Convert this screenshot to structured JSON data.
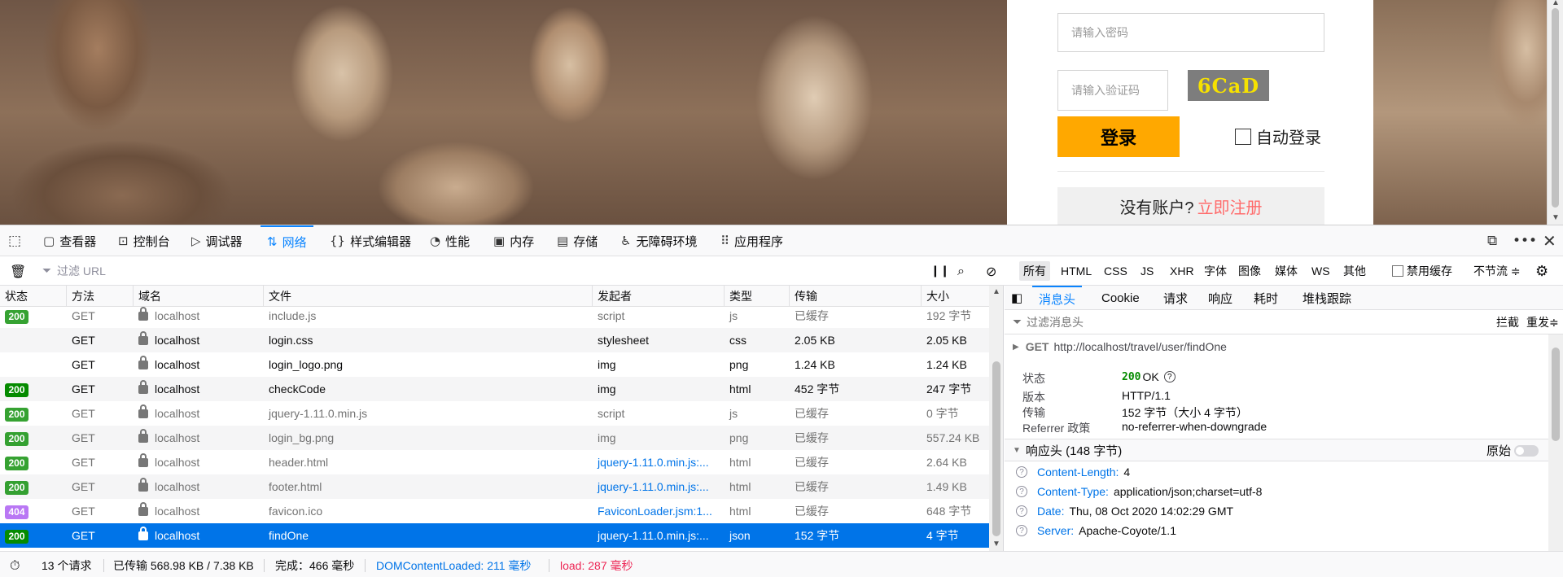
{
  "webpage": {
    "password_placeholder": "请输入密码",
    "captcha_placeholder": "请输入验证码",
    "captcha_code": "6CaD",
    "login_label": "登录",
    "auto_login_label": "自动登录",
    "no_account_text": "没有账户?",
    "register_link": "立即注册"
  },
  "devtools": {
    "tabs": [
      {
        "label": "查看器",
        "icon": "inspector-icon"
      },
      {
        "label": "控制台",
        "icon": "console-icon"
      },
      {
        "label": "调试器",
        "icon": "debugger-icon"
      },
      {
        "label": "网络",
        "icon": "network-icon"
      },
      {
        "label": "样式编辑器",
        "icon": "style-editor-icon"
      },
      {
        "label": "性能",
        "icon": "performance-icon"
      },
      {
        "label": "内存",
        "icon": "memory-icon"
      },
      {
        "label": "存储",
        "icon": "storage-icon"
      },
      {
        "label": "无障碍环境",
        "icon": "accessibility-icon"
      },
      {
        "label": "应用程序",
        "icon": "application-icon"
      }
    ],
    "active_tab": "网络",
    "filter_placeholder": "过滤 URL",
    "type_filters": [
      "所有",
      "HTML",
      "CSS",
      "JS",
      "XHR",
      "字体",
      "图像",
      "媒体",
      "WS",
      "其他"
    ],
    "active_type_filter": "所有",
    "disable_cache_label": "禁用缓存",
    "throttle_label": "不节流 ≑"
  },
  "requests": {
    "columns": [
      "状态",
      "方法",
      "域名",
      "文件",
      "发起者",
      "类型",
      "传输",
      "大小"
    ],
    "rows": [
      {
        "status": "200",
        "method": "GET",
        "domain": "localhost",
        "file": "include.js",
        "initiator": "script",
        "type": "js",
        "transferred": "已缓存",
        "size": "192 字节",
        "cached": true
      },
      {
        "status": "",
        "method": "GET",
        "domain": "localhost",
        "file": "login.css",
        "initiator": "stylesheet",
        "type": "css",
        "transferred": "2.05 KB",
        "size": "2.05 KB",
        "cached": false
      },
      {
        "status": "",
        "method": "GET",
        "domain": "localhost",
        "file": "login_logo.png",
        "initiator": "img",
        "type": "png",
        "transferred": "1.24 KB",
        "size": "1.24 KB",
        "cached": false
      },
      {
        "status": "200",
        "method": "GET",
        "domain": "localhost",
        "file": "checkCode",
        "initiator": "img",
        "type": "html",
        "transferred": "452 字节",
        "size": "247 字节",
        "cached": false
      },
      {
        "status": "200",
        "method": "GET",
        "domain": "localhost",
        "file": "jquery-1.11.0.min.js",
        "initiator": "script",
        "type": "js",
        "transferred": "已缓存",
        "size": "0 字节",
        "cached": true
      },
      {
        "status": "200",
        "method": "GET",
        "domain": "localhost",
        "file": "login_bg.png",
        "initiator": "img",
        "type": "png",
        "transferred": "已缓存",
        "size": "557.24 KB",
        "cached": true
      },
      {
        "status": "200",
        "method": "GET",
        "domain": "localhost",
        "file": "header.html",
        "initiator": "jquery-1.11.0.min.js:...",
        "type": "html",
        "transferred": "已缓存",
        "size": "2.64 KB",
        "cached": true,
        "initiator_link": true
      },
      {
        "status": "200",
        "method": "GET",
        "domain": "localhost",
        "file": "footer.html",
        "initiator": "jquery-1.11.0.min.js:...",
        "type": "html",
        "transferred": "已缓存",
        "size": "1.49 KB",
        "cached": true,
        "initiator_link": true
      },
      {
        "status": "404",
        "method": "GET",
        "domain": "localhost",
        "file": "favicon.ico",
        "initiator": "FaviconLoader.jsm:1...",
        "type": "html",
        "transferred": "已缓存",
        "size": "648 字节",
        "cached": true,
        "initiator_link": true
      },
      {
        "status": "200",
        "method": "GET",
        "domain": "localhost",
        "file": "findOne",
        "initiator": "jquery-1.11.0.min.js:...",
        "type": "json",
        "transferred": "152 字节",
        "size": "4 字节",
        "cached": false,
        "selected": true,
        "initiator_link": true
      }
    ]
  },
  "details": {
    "tabs": [
      "消息头",
      "Cookie",
      "请求",
      "响应",
      "耗时",
      "堆栈跟踪"
    ],
    "active_tab": "消息头",
    "filter_placeholder": "过滤消息头",
    "block_label": "拦截",
    "resend_label": "重发≑",
    "request_method": "GET",
    "request_url": "http://localhost/travel/user/findOne",
    "summary": {
      "status_label": "状态",
      "status_code": "200",
      "status_text": "OK",
      "version_label": "版本",
      "version": "HTTP/1.1",
      "transferred_label": "传输",
      "transferred": "152 字节（大小 4 字节）",
      "referrer_label": "Referrer 政策",
      "referrer": "no-referrer-when-downgrade"
    },
    "response_headers_title": "响应头 (148 字节)",
    "raw_label": "原始",
    "response_headers": [
      {
        "name": "Content-Length:",
        "value": "4"
      },
      {
        "name": "Content-Type:",
        "value": "application/json;charset=utf-8"
      },
      {
        "name": "Date:",
        "value": "Thu, 08 Oct 2020 14:02:29 GMT"
      },
      {
        "name": "Server:",
        "value": "Apache-Coyote/1.1"
      }
    ]
  },
  "status_bar": {
    "requests": "13 个请求",
    "transferred": "已传输 568.98 KB / 7.38 KB",
    "finish": "完成：466 毫秒",
    "dom_content_loaded": "DOMContentLoaded: 211 毫秒",
    "load": "load: 287 毫秒"
  },
  "colors": {
    "accent": "#0a84ff",
    "selected_row": "#0074e8",
    "status_200": "#058b00",
    "status_404": "#a856f2",
    "login_button": "#ffa800",
    "captcha_text": "#f6e100",
    "dom_loaded": "#0074e8",
    "load": "#ed2655"
  }
}
